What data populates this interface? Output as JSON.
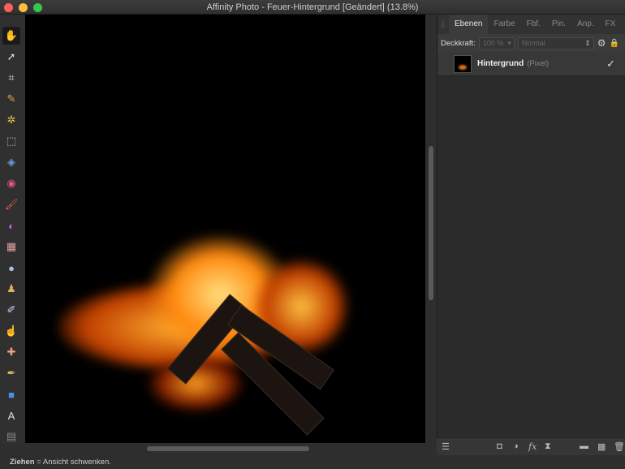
{
  "window": {
    "title": "Affinity Photo - Feuer-Hintergrund [Geändert] (13.8%)"
  },
  "tools": [
    {
      "name": "hand-icon",
      "glyph": "✋"
    },
    {
      "name": "move-icon",
      "glyph": "➚"
    },
    {
      "name": "crop-icon",
      "glyph": "⌗"
    },
    {
      "name": "selection-brush-icon",
      "glyph": "✎"
    },
    {
      "name": "flood-select-icon",
      "glyph": "✲"
    },
    {
      "name": "marquee-icon",
      "glyph": "⬚"
    },
    {
      "name": "fill-icon",
      "glyph": "◈"
    },
    {
      "name": "color-picker-icon",
      "glyph": "◉"
    },
    {
      "name": "paint-brush-icon",
      "glyph": "🖌"
    },
    {
      "name": "color-replace-icon",
      "glyph": "◐"
    },
    {
      "name": "erase-icon",
      "glyph": "▦"
    },
    {
      "name": "dodge-icon",
      "glyph": "●"
    },
    {
      "name": "clone-icon",
      "glyph": "♟"
    },
    {
      "name": "retouch-icon",
      "glyph": "✐"
    },
    {
      "name": "smudge-icon",
      "glyph": "☝"
    },
    {
      "name": "healing-icon",
      "glyph": "✚"
    },
    {
      "name": "pen-icon",
      "glyph": "✒"
    },
    {
      "name": "rectangle-icon",
      "glyph": "■"
    },
    {
      "name": "text-icon",
      "glyph": "A"
    },
    {
      "name": "mesh-icon",
      "glyph": "▤"
    }
  ],
  "panel": {
    "tabs": [
      "Ebenen",
      "Farbe",
      "Fbf.",
      "Pin.",
      "Anp.",
      "FX"
    ],
    "opacity_label": "Deckkraft:",
    "opacity_value": "100 %",
    "blend_mode": "Normal",
    "layers": [
      {
        "name": "Hintergrund",
        "type": "(Pixel)",
        "visible": "✓"
      }
    ]
  },
  "status": {
    "bold": "Ziehen",
    "text": " = Ansicht schwenken."
  }
}
